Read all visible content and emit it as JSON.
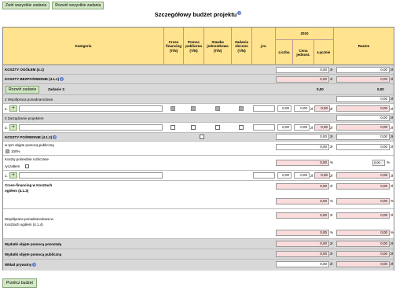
{
  "toolbar": {
    "collapse_all": "Zwiń wszystkie zadania",
    "expand_all": "Rozwiń wszystkie zadania"
  },
  "page": {
    "title": "Szczegółowy budżet projektu",
    "help": "?"
  },
  "headers": {
    "kategoria": "Kategoria",
    "cross": "Cross financing (T/N)",
    "pomoc": "Pomoc publiczna (T/N)",
    "stawka": "Stawka jednostkowa (T/N)",
    "zadania": "Zadania zlecone (T/N)",
    "jm": "j.m.",
    "year": "2010",
    "liczba": "Liczba",
    "cena": "Cena jednost.",
    "lacznie": "Łącznie",
    "razem": "Razem"
  },
  "rows": {
    "koszty_ogolem": "KOSZTY OGÓŁEM (4.1)",
    "koszty_bezposrednie": "KOSZTY BEZPOŚREDNIE (4.1.1)",
    "rozwin": "Rozwiń zadanie",
    "zadanie1": "Zadanie 1:",
    "wspolpraca": "2 Współpraca ponadnarodowa",
    "zarzadzanie": "3 Zarządzanie projektem",
    "posrednie": "KOSZTY POŚREDNIE (4.1.2)",
    "pomoc_publ": "w tym objęte pomocą publiczną",
    "pct100": "100%",
    "rozliczane": "Koszty pośrednie rozliczane",
    "ryczaltem": "ryczałtem",
    "cross_line1": "Cross-financing w Kosztach",
    "cross_line2": "ogółem (4.1.3)",
    "wspol_line1": "Współpraca ponadnarodowa w",
    "wspol_line2": "Kosztach ogółem (4.1.4)",
    "wyd_poz": "Wydatki objęte pomocą pozostałą",
    "wyd_publ": "Wydatki objęte pomocą publiczną",
    "wklad": "Wkład prywatny",
    "n2": "2.",
    "n3": "3.",
    "n1": "1."
  },
  "values": {
    "zero": "0,00",
    "zl": "zł",
    "pct": "%",
    "plus": "+",
    "sel_val": "0,00"
  },
  "footer": {
    "recalc": "Przelicz budżet"
  }
}
